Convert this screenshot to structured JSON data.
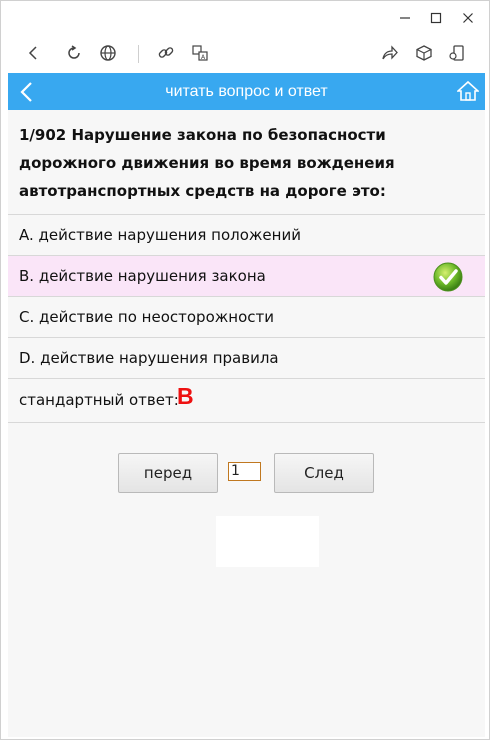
{
  "window": {
    "controls": [
      "minimize-icon",
      "maximize-icon",
      "close-icon"
    ]
  },
  "toolbar": {
    "icons": [
      "back-icon",
      "refresh-icon",
      "globe-icon",
      "link-icon",
      "translate-icon",
      "share-icon",
      "cube-icon",
      "device-icon"
    ]
  },
  "header": {
    "title": "читать вопрос и ответ",
    "color": "#38a8f0"
  },
  "question": {
    "text": "1/902 Нарушение закона по безопасности дорожного движения во время вожденеия автотранспортных средств на дороге это:"
  },
  "options": [
    {
      "label": "A. действие нарушения положений",
      "selected": false
    },
    {
      "label": "B. действие нарушения закона",
      "selected": true
    },
    {
      "label": "C. действие по неосторожности",
      "selected": false
    },
    {
      "label": "D. действие нарушения правила",
      "selected": false
    }
  ],
  "answer": {
    "label": "стандартный ответ:",
    "value": "B",
    "color": "#ee1111"
  },
  "pager": {
    "prev_label": "перед",
    "next_label": "След",
    "page_value": "1"
  }
}
